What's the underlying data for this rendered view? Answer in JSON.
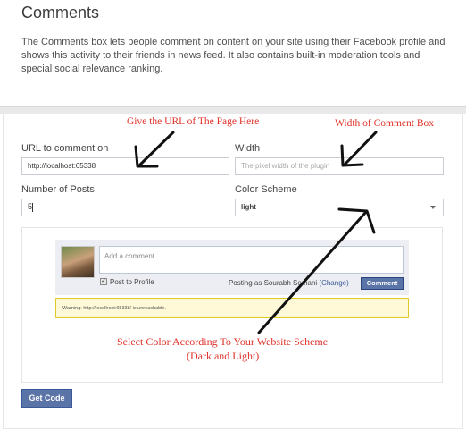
{
  "page": {
    "title": "Comments",
    "intro": "The Comments box lets people comment on content on your site using their Facebook profile and shows this activity to their friends in news feed. It also contains built-in moderation tools and special social relevance ranking."
  },
  "form": {
    "url_label": "URL to comment on",
    "url_value": "http://localhost:65338",
    "width_label": "Width",
    "width_placeholder": "The pixel width of the plugin",
    "posts_label": "Number of Posts",
    "posts_value": "5",
    "color_label": "Color Scheme",
    "color_value": "light"
  },
  "annotations": {
    "url_note": "Give the URL of The Page Here",
    "width_note": "Width of Comment Box",
    "color_note_line1": "Select Color According To Your Website Scheme",
    "color_note_line2": "(Dark and Light)"
  },
  "preview": {
    "comment_placeholder": "Add a comment...",
    "post_to_profile": "Post to Profile",
    "posting_as_prefix": "Posting as Sourabh Somani",
    "change_link": "(Change)",
    "comment_button": "Comment",
    "warning": "Warning: http://localhost:65338/ is unreachable."
  },
  "actions": {
    "get_code": "Get Code"
  },
  "colors": {
    "facebook_blue": "#5b74a8",
    "annotation_red": "#e03028",
    "warning_bg": "#fff9d7"
  }
}
